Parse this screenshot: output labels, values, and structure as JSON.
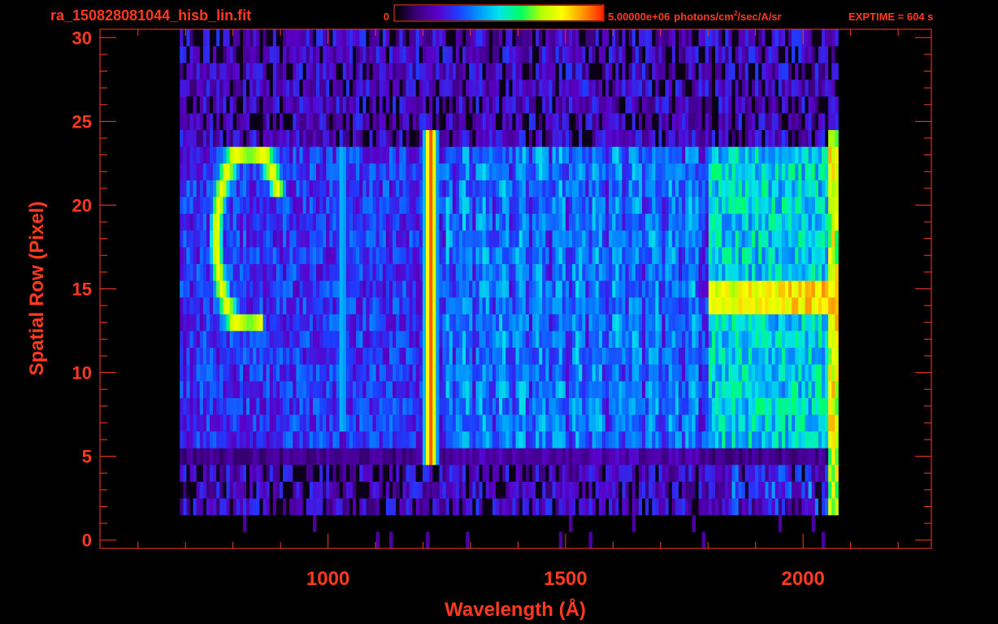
{
  "header": {
    "filename": "ra_150828081044_hisb_lin.fit",
    "colorbar_min": "0",
    "colorbar_max_value": "5.00000e+06",
    "colorbar_unit_pre": "photons/cm",
    "colorbar_unit_sup": "2",
    "colorbar_unit_post": "/sec/A/sr",
    "exptime": "EXPTIME = 604 s"
  },
  "colors": {
    "background": "#000000",
    "axis_and_text": "#ff3a1e",
    "colormap": [
      "#000000",
      "#3a0078",
      "#5a00c8",
      "#1e3cff",
      "#0096ff",
      "#00e6e6",
      "#00ff64",
      "#b4ff00",
      "#ffff00",
      "#ff9600",
      "#ff1e00"
    ]
  },
  "chart_data": {
    "type": "heatmap",
    "title": "ra_150828081044_hisb_lin.fit",
    "xlabel": "Wavelength (Å)",
    "ylabel": "Spatial Row (Pixel)",
    "xlim": [
      520,
      2270
    ],
    "ylim": [
      -0.5,
      30.5
    ],
    "x_ticks": [
      1000,
      1500,
      2000
    ],
    "y_ticks": [
      0,
      5,
      10,
      15,
      20,
      25,
      30
    ],
    "colorbar_range": [
      0,
      5000000
    ],
    "colorbar_unit": "photons/cm^2/sec/A/sr",
    "exptime_s": 604,
    "detector": {
      "signal_x_range": [
        690,
        2075
      ],
      "illuminated_rows": [
        5,
        23
      ],
      "noise_rows": [
        [
          2,
          4
        ],
        [
          24,
          30
        ]
      ]
    },
    "features": [
      {
        "name": "bright arc",
        "x_range": [
          760,
          900
        ],
        "rows": [
          13,
          23
        ],
        "peak": 0.78
      },
      {
        "name": "emission line",
        "x": 1216,
        "rows": [
          5,
          24
        ],
        "peak": 0.95
      },
      {
        "name": "emission band",
        "x": 1030,
        "rows": [
          7,
          23
        ],
        "peak": 0.45
      },
      {
        "name": "bright strip",
        "x_range": [
          1800,
          2065
        ],
        "rows": [
          14,
          15
        ],
        "peak": 0.82
      },
      {
        "name": "red continuum",
        "x_range": [
          1800,
          2065
        ],
        "rows": [
          6,
          23
        ],
        "peak": 0.55
      }
    ]
  }
}
